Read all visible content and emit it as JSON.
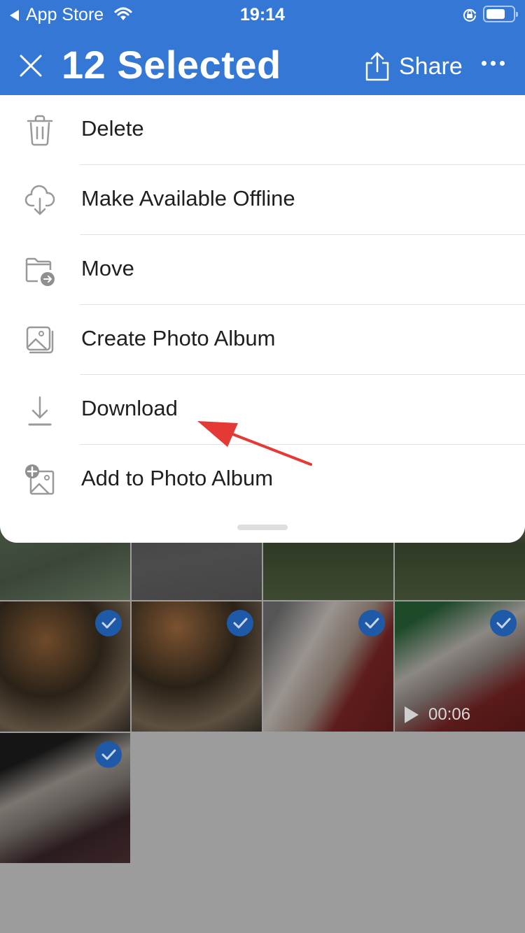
{
  "status_bar": {
    "back_app": "App Store",
    "time": "19:14"
  },
  "header": {
    "title": "12 Selected",
    "share_label": "Share",
    "accent_color": "#3577d4"
  },
  "menu": {
    "items": [
      {
        "label": "Delete",
        "icon": "trash-icon"
      },
      {
        "label": "Make Available Offline",
        "icon": "cloud-download-icon"
      },
      {
        "label": "Move",
        "icon": "folder-move-icon"
      },
      {
        "label": "Create Photo Album",
        "icon": "photo-album-icon"
      },
      {
        "label": "Download",
        "icon": "download-icon"
      },
      {
        "label": "Add to Photo Album",
        "icon": "add-photo-icon"
      }
    ]
  },
  "photos": {
    "tiles": [
      {
        "subject": "grass",
        "selected": false
      },
      {
        "subject": "cat on pavement",
        "selected": false
      },
      {
        "subject": "plants and person",
        "selected": false
      },
      {
        "subject": "plants and person",
        "selected": false
      },
      {
        "subject": "dog in grass",
        "selected": true
      },
      {
        "subject": "dog in grass",
        "selected": true
      },
      {
        "subject": "cat sleeping",
        "selected": true
      },
      {
        "subject": "cat on rug",
        "selected": true,
        "video_duration": "00:06"
      },
      {
        "subject": "optical drive in hand",
        "selected": true
      }
    ]
  },
  "annotation": {
    "arrow_color": "#e53935",
    "points_to": "Download"
  }
}
